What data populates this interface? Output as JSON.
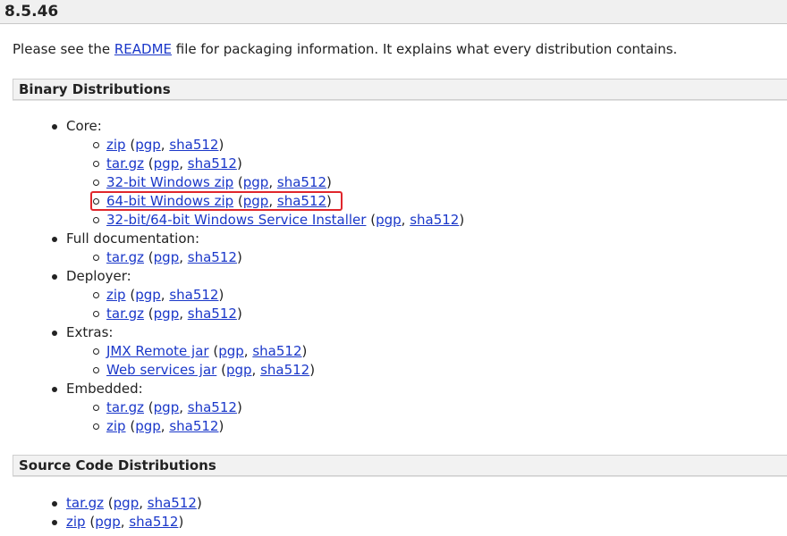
{
  "version": "8.5.46",
  "intro": {
    "before": "Please see the ",
    "link": "README",
    "after": " file for packaging information. It explains what every distribution contains."
  },
  "binary": {
    "title": "Binary Distributions",
    "groups": [
      {
        "label": "Core:",
        "items": [
          {
            "main": "zip",
            "sig1": "pgp",
            "sig2": "sha512"
          },
          {
            "main": "tar.gz",
            "sig1": "pgp",
            "sig2": "sha512"
          },
          {
            "main": "32-bit Windows zip",
            "sig1": "pgp",
            "sig2": "sha512"
          },
          {
            "main": "64-bit Windows zip",
            "sig1": "pgp",
            "sig2": "sha512"
          },
          {
            "main": "32-bit/64-bit Windows Service Installer",
            "sig1": "pgp",
            "sig2": "sha512"
          }
        ]
      },
      {
        "label": "Full documentation:",
        "items": [
          {
            "main": "tar.gz",
            "sig1": "pgp",
            "sig2": "sha512"
          }
        ]
      },
      {
        "label": "Deployer:",
        "items": [
          {
            "main": "zip",
            "sig1": "pgp",
            "sig2": "sha512"
          },
          {
            "main": "tar.gz",
            "sig1": "pgp",
            "sig2": "sha512"
          }
        ]
      },
      {
        "label": "Extras:",
        "items": [
          {
            "main": "JMX Remote jar",
            "sig1": "pgp",
            "sig2": "sha512"
          },
          {
            "main": "Web services jar",
            "sig1": "pgp",
            "sig2": "sha512"
          }
        ]
      },
      {
        "label": "Embedded:",
        "items": [
          {
            "main": "tar.gz",
            "sig1": "pgp",
            "sig2": "sha512"
          },
          {
            "main": "zip",
            "sig1": "pgp",
            "sig2": "sha512"
          }
        ]
      }
    ]
  },
  "source": {
    "title": "Source Code Distributions",
    "items": [
      {
        "main": "tar.gz",
        "sig1": "pgp",
        "sig2": "sha512"
      },
      {
        "main": "zip",
        "sig1": "pgp",
        "sig2": "sha512"
      }
    ]
  },
  "colors": {
    "link": "#1a37c9",
    "highlight": "#e0262c",
    "section_bg": "#f2f2f2"
  }
}
